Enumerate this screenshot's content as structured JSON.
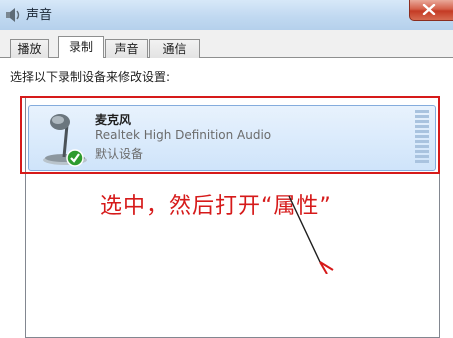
{
  "window": {
    "title": "声音"
  },
  "tabs": [
    {
      "label": "播放"
    },
    {
      "label": "录制"
    },
    {
      "label": "声音"
    },
    {
      "label": "通信"
    }
  ],
  "instruction": "选择以下录制设备来修改设置:",
  "device": {
    "name": "麦克风",
    "driver": "Realtek High Definition Audio",
    "status": "默认设备",
    "icon": "microphone-icon",
    "badge": "green-check-icon"
  },
  "annotation": {
    "text": "选中，然后打开“属性”",
    "color": "#d61a1a"
  }
}
